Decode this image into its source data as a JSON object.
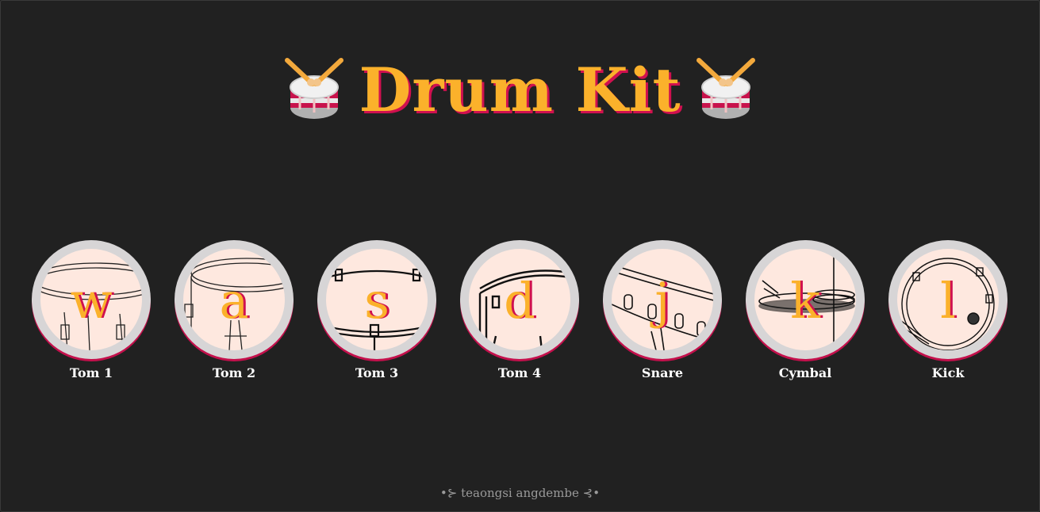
{
  "title": "Drum Kit",
  "title_icon": "drum-emoji",
  "colors": {
    "background": "#212121",
    "accent": "#fbb12b",
    "shadow": "#d0104f",
    "pad_face": "#fee8df",
    "pad_ring": "#d7d5d6"
  },
  "drums": [
    {
      "key": "w",
      "label": "Tom 1",
      "icon": "tom-drum-sketch"
    },
    {
      "key": "a",
      "label": "Tom 2",
      "icon": "tom-drum-sketch"
    },
    {
      "key": "s",
      "label": "Tom 3",
      "icon": "tom-drum-sketch"
    },
    {
      "key": "d",
      "label": "Tom 4",
      "icon": "tom-drum-sketch"
    },
    {
      "key": "j",
      "label": "Snare",
      "icon": "snare-drum-sketch"
    },
    {
      "key": "k",
      "label": "Cymbal",
      "icon": "cymbal-sketch"
    },
    {
      "key": "l",
      "label": "Kick",
      "icon": "kick-drum-sketch"
    }
  ],
  "footer": "•⊱ teaongsi angdembe ⊰•"
}
